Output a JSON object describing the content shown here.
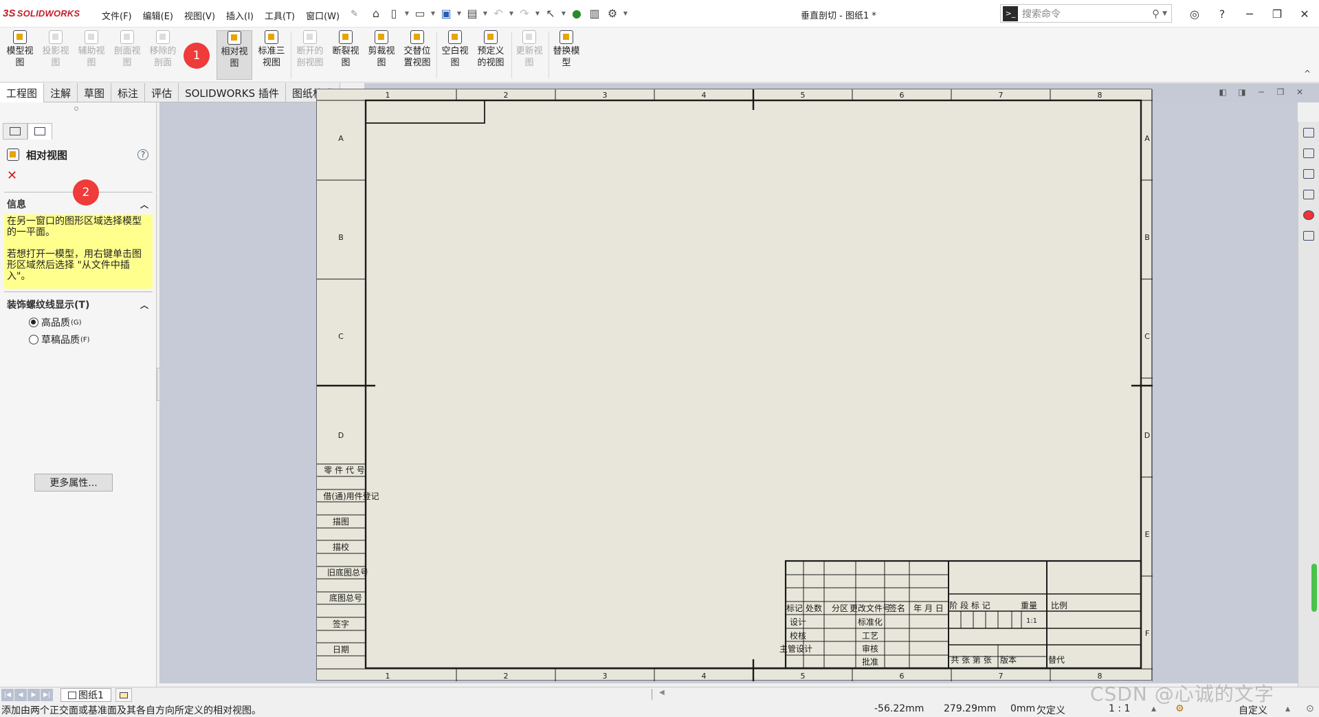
{
  "app": {
    "logo": "SOLIDWORKS",
    "doc_title": "垂直剖切 - 图纸1 *"
  },
  "menu": [
    "文件(F)",
    "编辑(E)",
    "视图(V)",
    "插入(I)",
    "工具(T)",
    "窗口(W)"
  ],
  "search": {
    "placeholder": "搜索命令"
  },
  "ribbon": {
    "buttons": [
      {
        "label1": "模型视",
        "label2": "图",
        "state": "enabled"
      },
      {
        "label1": "投影视",
        "label2": "图",
        "state": "disabled"
      },
      {
        "label1": "辅助视",
        "label2": "图",
        "state": "disabled"
      },
      {
        "label1": "剖面视",
        "label2": "图",
        "state": "disabled"
      },
      {
        "label1": "移除的",
        "label2": "剖面",
        "state": "disabled"
      },
      {
        "label1": "相对视",
        "label2": "图",
        "state": "active"
      },
      {
        "label1": "标准三",
        "label2": "视图",
        "state": "enabled"
      },
      {
        "label1": "断开的",
        "label2": "剖视图",
        "state": "disabled"
      },
      {
        "label1": "断裂视",
        "label2": "图",
        "state": "enabled"
      },
      {
        "label1": "剪裁视",
        "label2": "图",
        "state": "enabled"
      },
      {
        "label1": "交替位",
        "label2": "置视图",
        "state": "enabled"
      },
      {
        "label1": "空白视",
        "label2": "图",
        "state": "enabled"
      },
      {
        "label1": "预定义",
        "label2": "的视图",
        "state": "enabled"
      },
      {
        "label1": "更新视",
        "label2": "图",
        "state": "disabled"
      },
      {
        "label1": "替换模",
        "label2": "型",
        "state": "enabled"
      }
    ],
    "badge1": "1"
  },
  "tabs": [
    "工程图",
    "注解",
    "草图",
    "标注",
    "评估",
    "SOLIDWORKS 插件",
    "图纸格式"
  ],
  "panel": {
    "title": "相对视图",
    "help": "?",
    "badge2": "2",
    "info_header": "信息",
    "info_text1": "在另一窗口的图形区域选择模型的一平面。",
    "info_text2": "若想打开一模型，用右键单击图形区域然后选择 \"从文件中插入\"。",
    "thread_header": "装饰螺纹线显示(T)",
    "radio_high": "高品质",
    "radio_high_key": "(G)",
    "radio_draft": "草稿品质",
    "radio_draft_key": "(F)",
    "more_button": "更多属性..."
  },
  "drawing": {
    "top_cols": [
      "1",
      "2",
      "3",
      "4",
      "5",
      "6",
      "7",
      "8"
    ],
    "rows": [
      "A",
      "B",
      "C",
      "D",
      "E",
      "F"
    ],
    "left_strip": [
      "零 件 代 号",
      "借(通)用件登记",
      "描图",
      "描校",
      "旧底图总号",
      "底图总号",
      "签字",
      "日期"
    ],
    "tb_header": [
      "标记",
      "处数",
      "分区",
      "更改文件号",
      "签名",
      "年 月 日"
    ],
    "tb_roles_left": [
      "设计",
      "校核",
      "主管设计"
    ],
    "tb_roles_mid": [
      "标准化",
      "工艺",
      "审核",
      "批准"
    ],
    "tb_stage": "阶 段 标 记",
    "tb_weight": "重量",
    "tb_scale": "比例",
    "tb_scale_val": "1:1",
    "tb_sheets": "共  张 第  张",
    "tb_version": "版本",
    "tb_replace": "替代"
  },
  "sheet_tab": "图纸1",
  "status": {
    "message": "添加由两个正交面或基准面及其各自方向所定义的相对视图。",
    "x": "-56.22mm",
    "y": "279.29mm",
    "z": "0mm",
    "state": "欠定义",
    "scale": "1 : 1",
    "units": "自定义"
  },
  "watermark": "CSDN @心诚的文字"
}
